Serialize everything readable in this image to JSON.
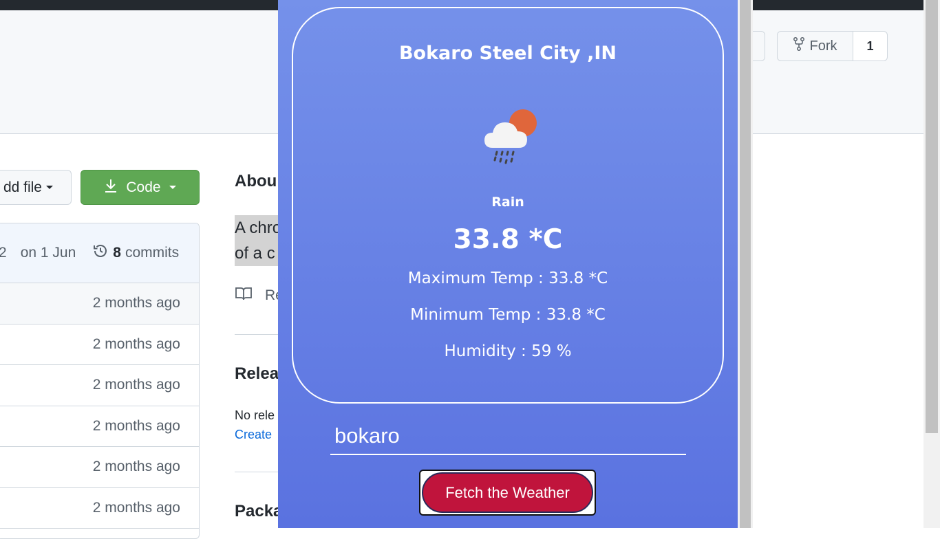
{
  "github": {
    "fork_label": "Fork",
    "fork_count": "1",
    "add_file_label": "dd file",
    "code_label": "Code",
    "commit_date": "on 1 Jun",
    "commit_prefix_glyph": "2",
    "commit_count": "8",
    "commit_word": "commits",
    "file_rows": [
      "2 months ago",
      "2 months ago",
      "2 months ago",
      "2 months ago",
      "2 months ago",
      "2 months ago"
    ],
    "about_heading": "Abou",
    "about_desc_line1": "A chro",
    "about_desc_line2": "of a c",
    "readme_label": "Re",
    "releases_heading": "Relea",
    "releases_none": "No rele",
    "releases_create": "Create",
    "packages_heading": "Packa"
  },
  "weather": {
    "city": "Bokaro Steel City ,IN",
    "icon": "rain-cloud-sun-icon",
    "condition": "Rain",
    "temperature": "33.8 *C",
    "max_temp": "Maximum Temp : 33.8 *C",
    "min_temp": "Minimum Temp : 33.8 *C",
    "humidity": "Humidity : 59 %",
    "input_value": "bokaro",
    "button_label": "Fetch the Weather"
  },
  "colors": {
    "popup_top": "#7591ea",
    "popup_bottom": "#5a72e0",
    "fetch_button": "#c0143c",
    "code_button": "#5fa854"
  }
}
